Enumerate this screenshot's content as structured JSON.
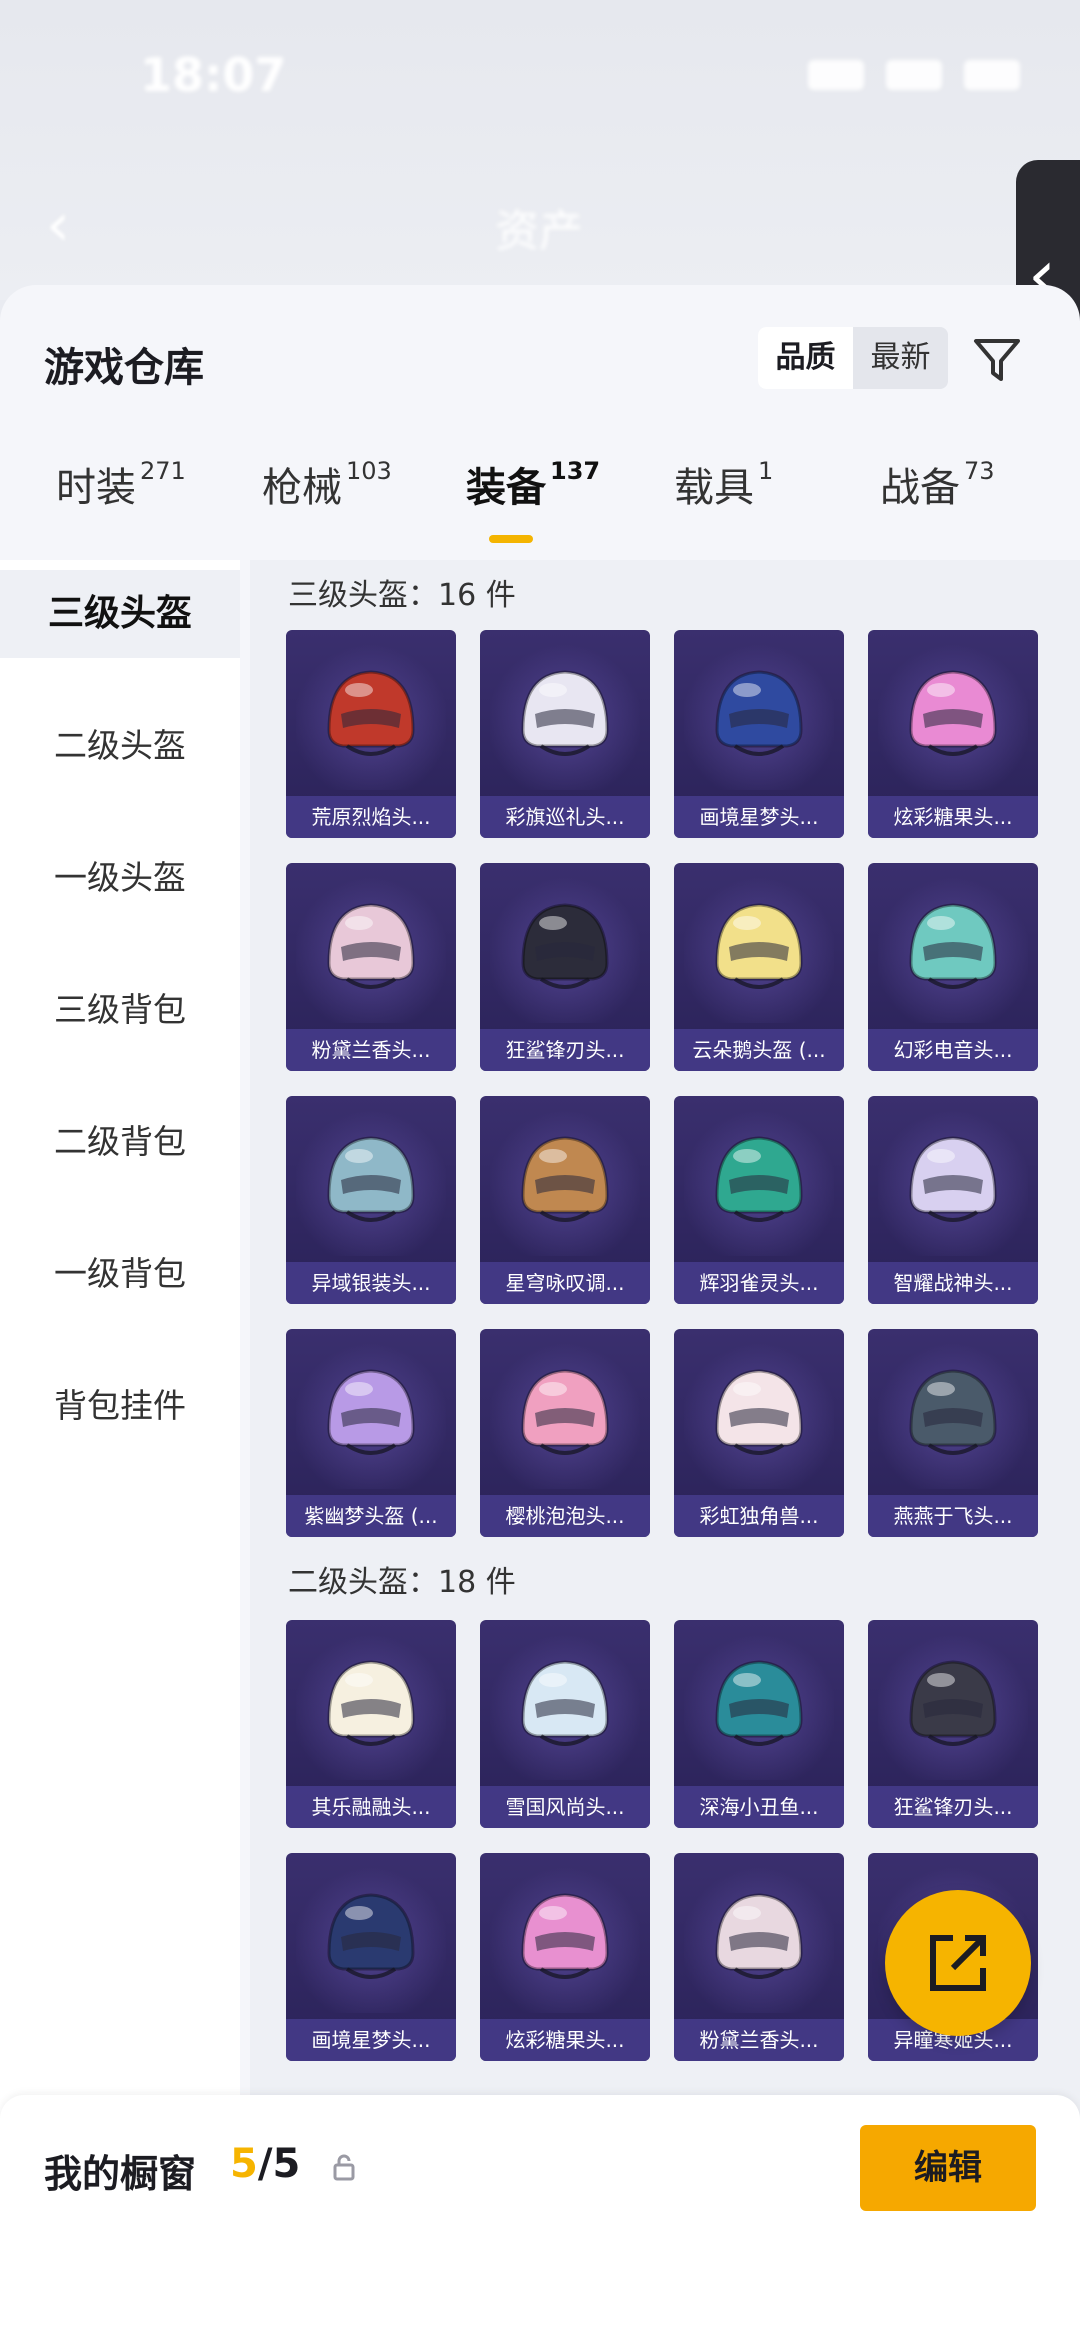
{
  "status_bar": {
    "time": "18:07"
  },
  "nav": {
    "title": "资产"
  },
  "header": {
    "title": "游戏仓库",
    "sort_quality": "品质",
    "sort_newest": "最新"
  },
  "tabs": [
    {
      "label": "时装",
      "count": "271"
    },
    {
      "label": "枪械",
      "count": "103"
    },
    {
      "label": "装备",
      "count": "137"
    },
    {
      "label": "载具",
      "count": "1"
    },
    {
      "label": "战备",
      "count": "73"
    }
  ],
  "categories": [
    "三级头盔",
    "二级头盔",
    "一级头盔",
    "三级背包",
    "二级背包",
    "一级背包",
    "背包挂件"
  ],
  "sections": [
    {
      "title": "三级头盔：16 件",
      "items": [
        {
          "name": "荒原烈焰头...",
          "color": "#c0392b"
        },
        {
          "name": "彩旗巡礼头...",
          "color": "#e8e6f2"
        },
        {
          "name": "画境星梦头...",
          "color": "#2f4aa0"
        },
        {
          "name": "炫彩糖果头...",
          "color": "#e98ad3"
        },
        {
          "name": "粉黛兰香头...",
          "color": "#e8c8d8"
        },
        {
          "name": "狂鲨锋刃头...",
          "color": "#2c2c3a"
        },
        {
          "name": "云朵鹅头盔 (...",
          "color": "#f2e08a"
        },
        {
          "name": "幻彩电音头...",
          "color": "#6fc9c0"
        },
        {
          "name": "异域银装头...",
          "color": "#8fb8c8"
        },
        {
          "name": "星穹咏叹调...",
          "color": "#c08850"
        },
        {
          "name": "辉羽雀灵头...",
          "color": "#2fa890"
        },
        {
          "name": "智耀战神头...",
          "color": "#d8d0f0"
        },
        {
          "name": "紫幽梦头盔 (...",
          "color": "#b89ae6"
        },
        {
          "name": "樱桃泡泡头...",
          "color": "#f0a0c0"
        },
        {
          "name": "彩虹独角兽...",
          "color": "#f4e4e8"
        },
        {
          "name": "燕燕于飞头...",
          "color": "#4a5a6a"
        }
      ]
    },
    {
      "title": "二级头盔：18 件",
      "items": [
        {
          "name": "其乐融融头...",
          "color": "#f6f0e0"
        },
        {
          "name": "雪国风尚头...",
          "color": "#d8e8f4"
        },
        {
          "name": "深海小丑鱼...",
          "color": "#2a8c9a"
        },
        {
          "name": "狂鲨锋刃头...",
          "color": "#3a3a48"
        },
        {
          "name": "画境星梦头...",
          "color": "#2a3a70"
        },
        {
          "name": "炫彩糖果头...",
          "color": "#e890d0"
        },
        {
          "name": "粉黛兰香头...",
          "color": "#e8d8e0"
        },
        {
          "name": "异瞳寒姬头...",
          "color": "#9090b0"
        }
      ]
    }
  ],
  "bottom": {
    "label": "我的橱窗",
    "count_current": "5",
    "count_sep": "/5",
    "edit_label": "编辑"
  },
  "accent": "#f6b400"
}
